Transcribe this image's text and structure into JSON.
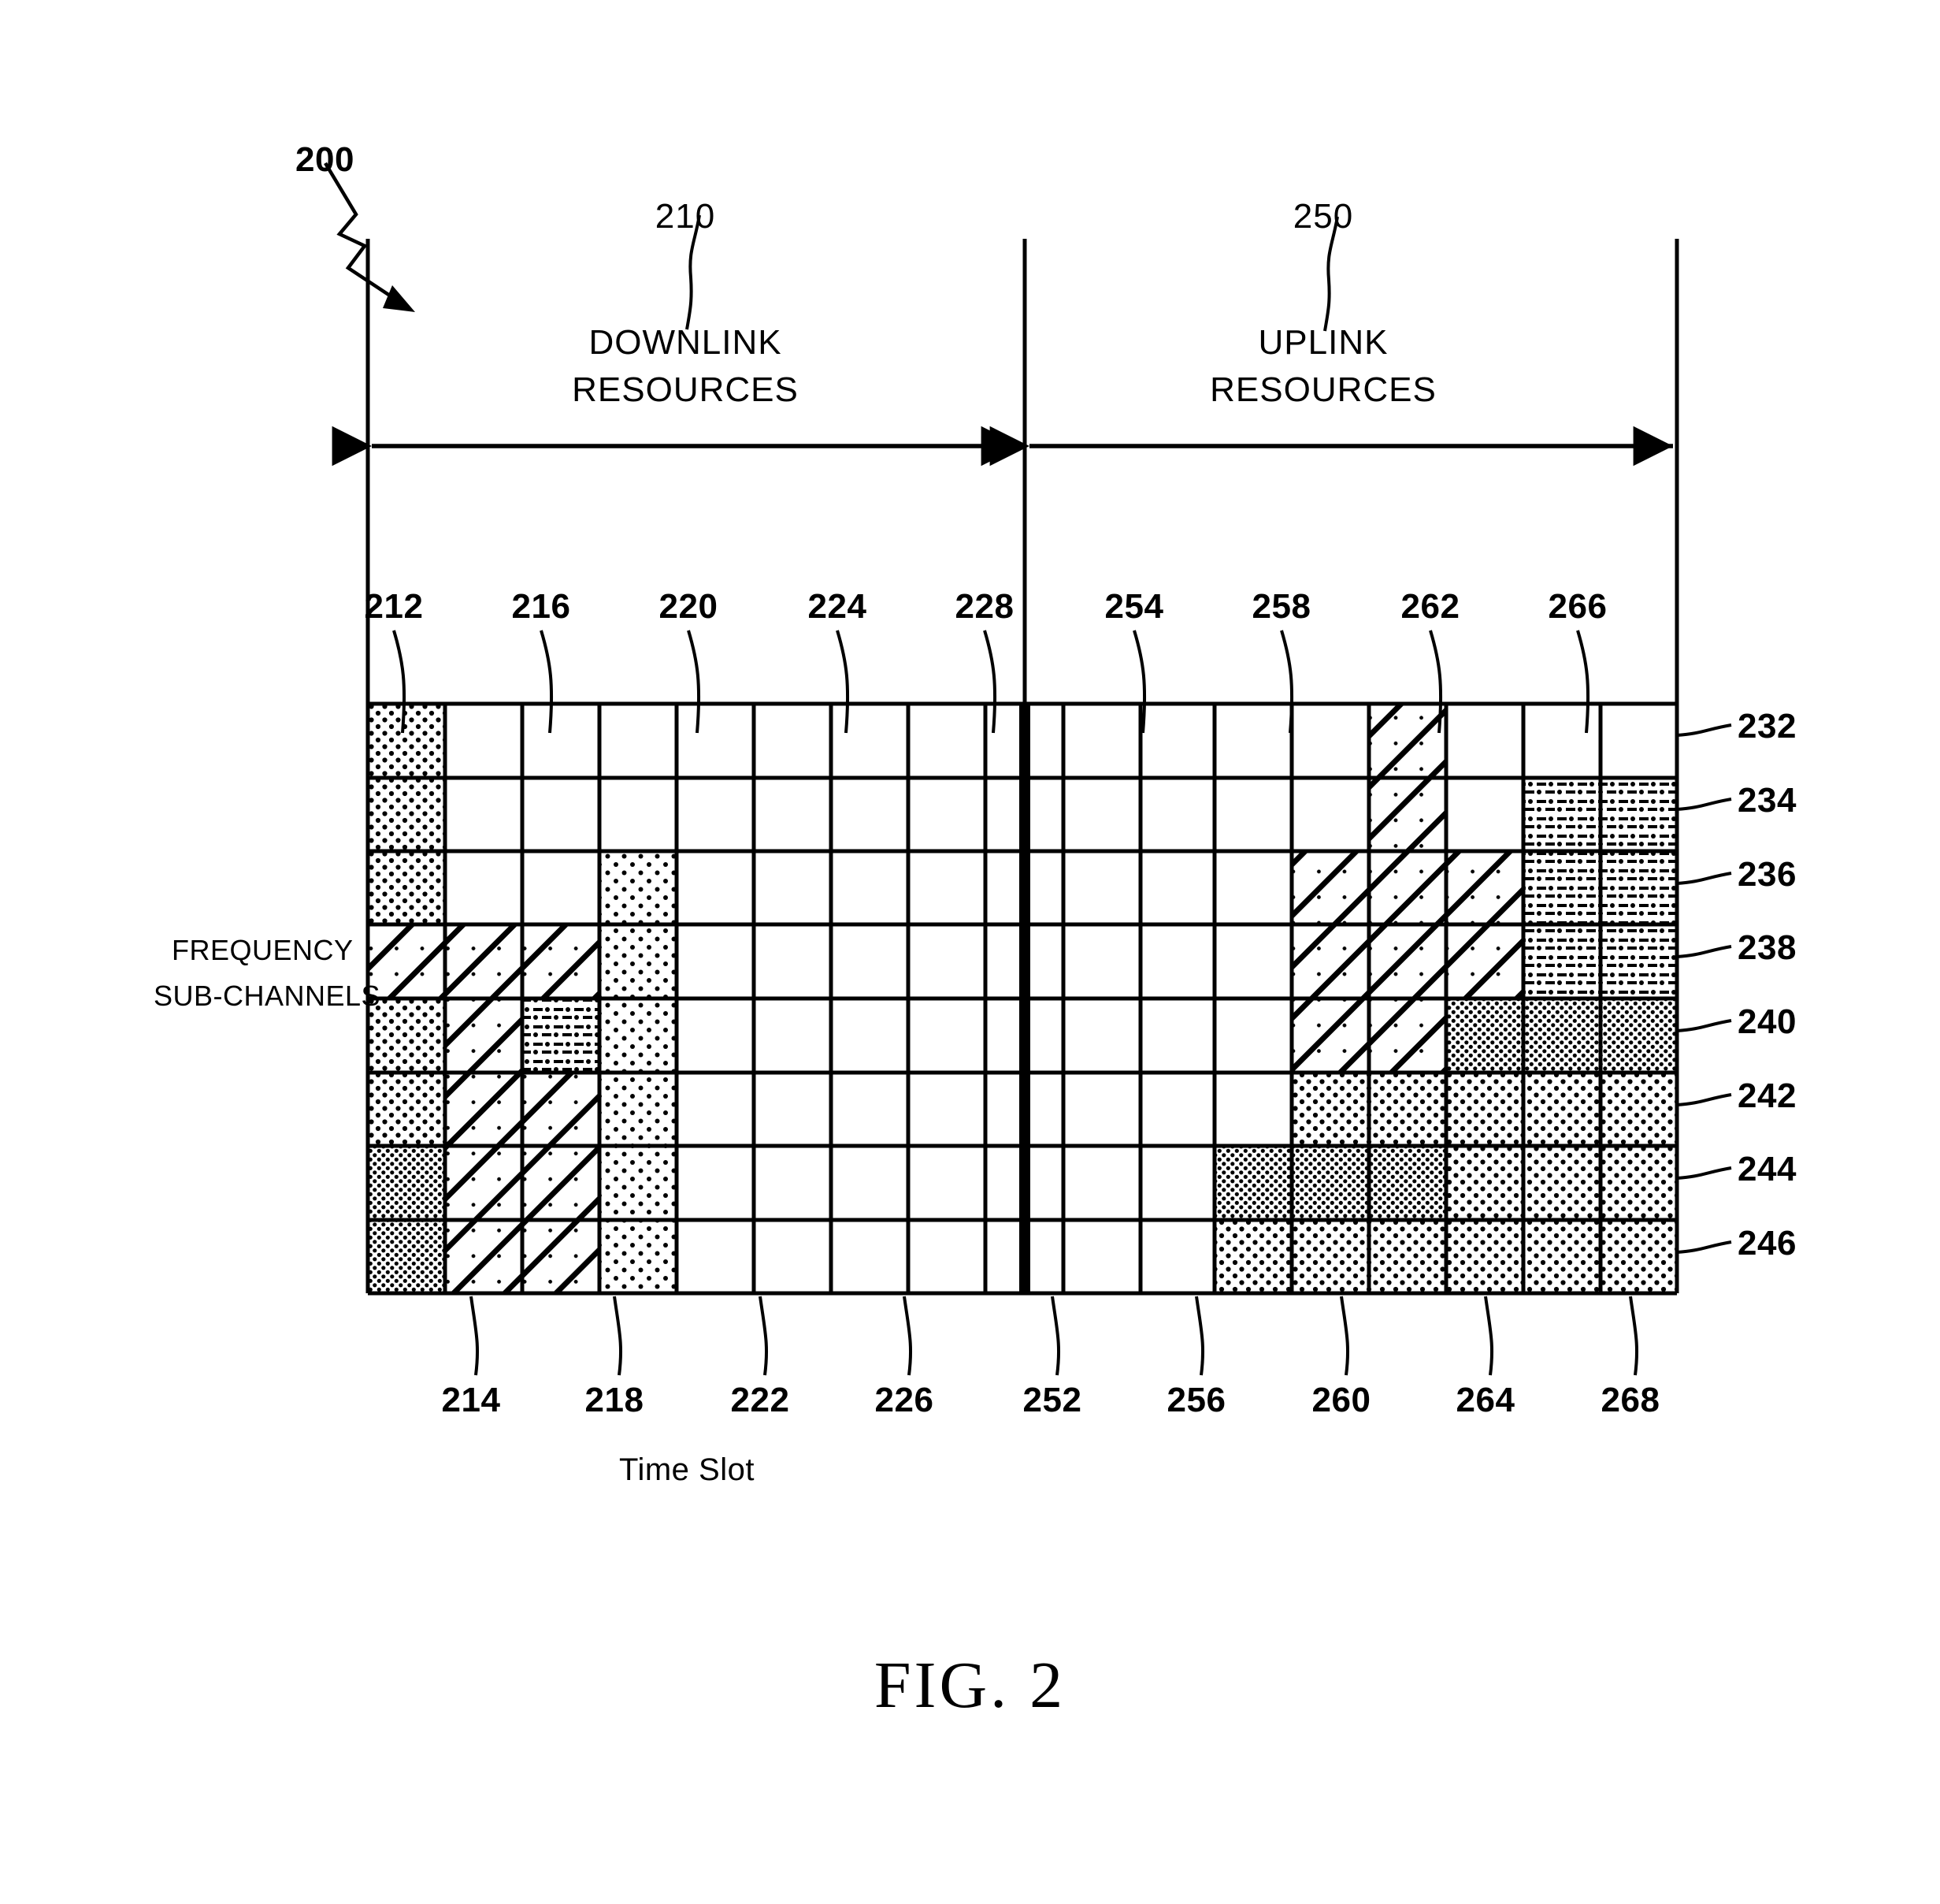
{
  "figure": {
    "caption": "FIG. 2",
    "main_ref": "200"
  },
  "headers": {
    "downlink": {
      "line1": "DOWNLINK",
      "line2": "RESOURCES",
      "ref": "210"
    },
    "uplink": {
      "line1": "UPLINK",
      "line2": "RESOURCES",
      "ref": "250"
    }
  },
  "axes": {
    "y_label_line1": "FREQUENCY",
    "y_label_line2": "SUB-CHANNELS",
    "x_label": "Time Slot"
  },
  "top_refs": [
    "212",
    "216",
    "220",
    "224",
    "228",
    "254",
    "258",
    "262",
    "266"
  ],
  "bottom_refs": [
    "214",
    "218",
    "222",
    "226",
    "252",
    "256",
    "260",
    "264",
    "268"
  ],
  "row_refs": [
    "232",
    "234",
    "236",
    "238",
    "240",
    "242",
    "244",
    "246"
  ],
  "colors": {
    "ink": "#000000",
    "paper": "#ffffff"
  },
  "chart_data": {
    "type": "heatmap",
    "title": "Downlink / Uplink resource allocation map",
    "xlabel": "Time Slot",
    "ylabel": "FREQUENCY SUB-CHANNELS",
    "grid": true,
    "legend_position": "none",
    "columns": 17,
    "rows": 8,
    "downlink_columns": 9,
    "uplink_columns": 8,
    "row_labels": [
      "232",
      "234",
      "236",
      "238",
      "240",
      "242",
      "244",
      "246"
    ],
    "column_refs_top": [
      "212",
      "216",
      "220",
      "224",
      "228",
      "254",
      "258",
      "262",
      "266"
    ],
    "column_refs_bottom": [
      "214",
      "218",
      "222",
      "226",
      "252",
      "256",
      "260",
      "264",
      "268"
    ],
    "pattern_key": {
      "blank": "empty / unallocated cell",
      "dots-med": "medium dot stipple",
      "dots-dense": "dense dot stipple",
      "dots-sparse": "sparse dot stipple",
      "hatch-dots": "diagonal hatch over dots",
      "dash-dots": "dash and dot stipple"
    },
    "cells": [
      {
        "col": 0,
        "row": 0,
        "rowspan": 3,
        "pattern": "dots-med",
        "ref": "212"
      },
      {
        "col": 0,
        "row": 3,
        "rowspan": 1,
        "pattern": "hatch-dots",
        "colspan": 3,
        "ref": "214"
      },
      {
        "col": 0,
        "row": 4,
        "rowspan": 2,
        "pattern": "dots-med"
      },
      {
        "col": 0,
        "row": 6,
        "rowspan": 2,
        "pattern": "dots-dense"
      },
      {
        "col": 1,
        "row": 4,
        "rowspan": 4,
        "pattern": "hatch-dots",
        "ref": "214"
      },
      {
        "col": 2,
        "row": 4,
        "rowspan": 1,
        "pattern": "dash-dots"
      },
      {
        "col": 2,
        "row": 5,
        "rowspan": 2,
        "pattern": "hatch-dots"
      },
      {
        "col": 2,
        "row": 7,
        "rowspan": 1,
        "pattern": "hatch-dots"
      },
      {
        "col": 3,
        "row": 2,
        "rowspan": 6,
        "pattern": "dots-sparse",
        "ref": "218"
      },
      {
        "col": 13,
        "row": 0,
        "rowspan": 5,
        "pattern": "hatch-dots",
        "ref": "262"
      },
      {
        "col": 12,
        "row": 2,
        "rowspan": 5,
        "pattern": "hatch-dots"
      },
      {
        "col": 14,
        "row": 2,
        "rowspan": 2,
        "pattern": "hatch-dots",
        "ref": "266"
      },
      {
        "col": 15,
        "row": 1,
        "rowspan": 3,
        "pattern": "dash-dots"
      },
      {
        "col": 14,
        "row": 4,
        "rowspan": 1,
        "colspan": 2,
        "pattern": "dots-dense"
      },
      {
        "col": 12,
        "row": 5,
        "rowspan": 3,
        "pattern": "dots-med"
      },
      {
        "col": 11,
        "row": 6,
        "rowspan": 1,
        "colspan": 3,
        "pattern": "dots-dense"
      },
      {
        "col": 11,
        "row": 7,
        "rowspan": 1,
        "colspan": 3,
        "pattern": "dots-med",
        "ref": "260"
      },
      {
        "col": 14,
        "row": 5,
        "rowspan": 3,
        "colspan": 2,
        "pattern": "dots-med",
        "ref": "268"
      }
    ]
  }
}
